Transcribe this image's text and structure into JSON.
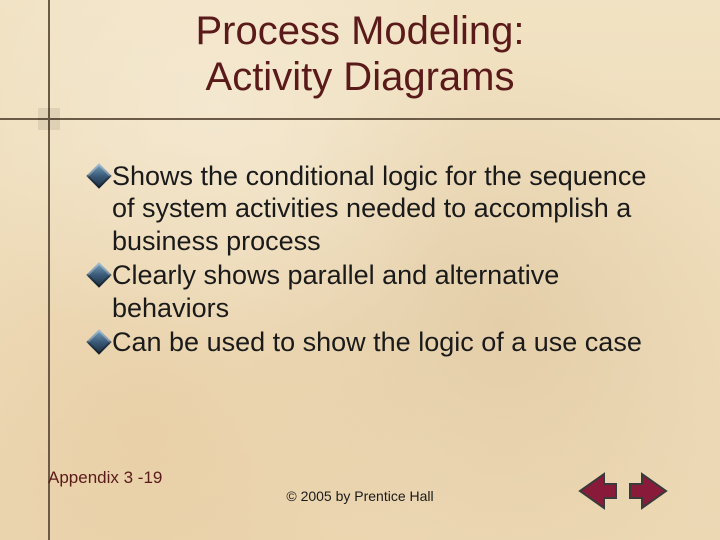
{
  "title": {
    "line1": "Process Modeling:",
    "line2": "Activity Diagrams"
  },
  "bullets": [
    "Shows the conditional logic for the sequence of system activities needed to accomplish a business process",
    "Clearly shows parallel and alternative behaviors",
    "Can be used to show the logic of a use case"
  ],
  "footer": {
    "left": "Appendix 3 -19",
    "center": "© 2005 by Prentice Hall"
  },
  "colors": {
    "title": "#5a1a1a",
    "body": "#1a1a1a",
    "line": "#6b5a46",
    "nav_fill": "#8a1a3a",
    "nav_stroke": "#3a3a3a"
  }
}
